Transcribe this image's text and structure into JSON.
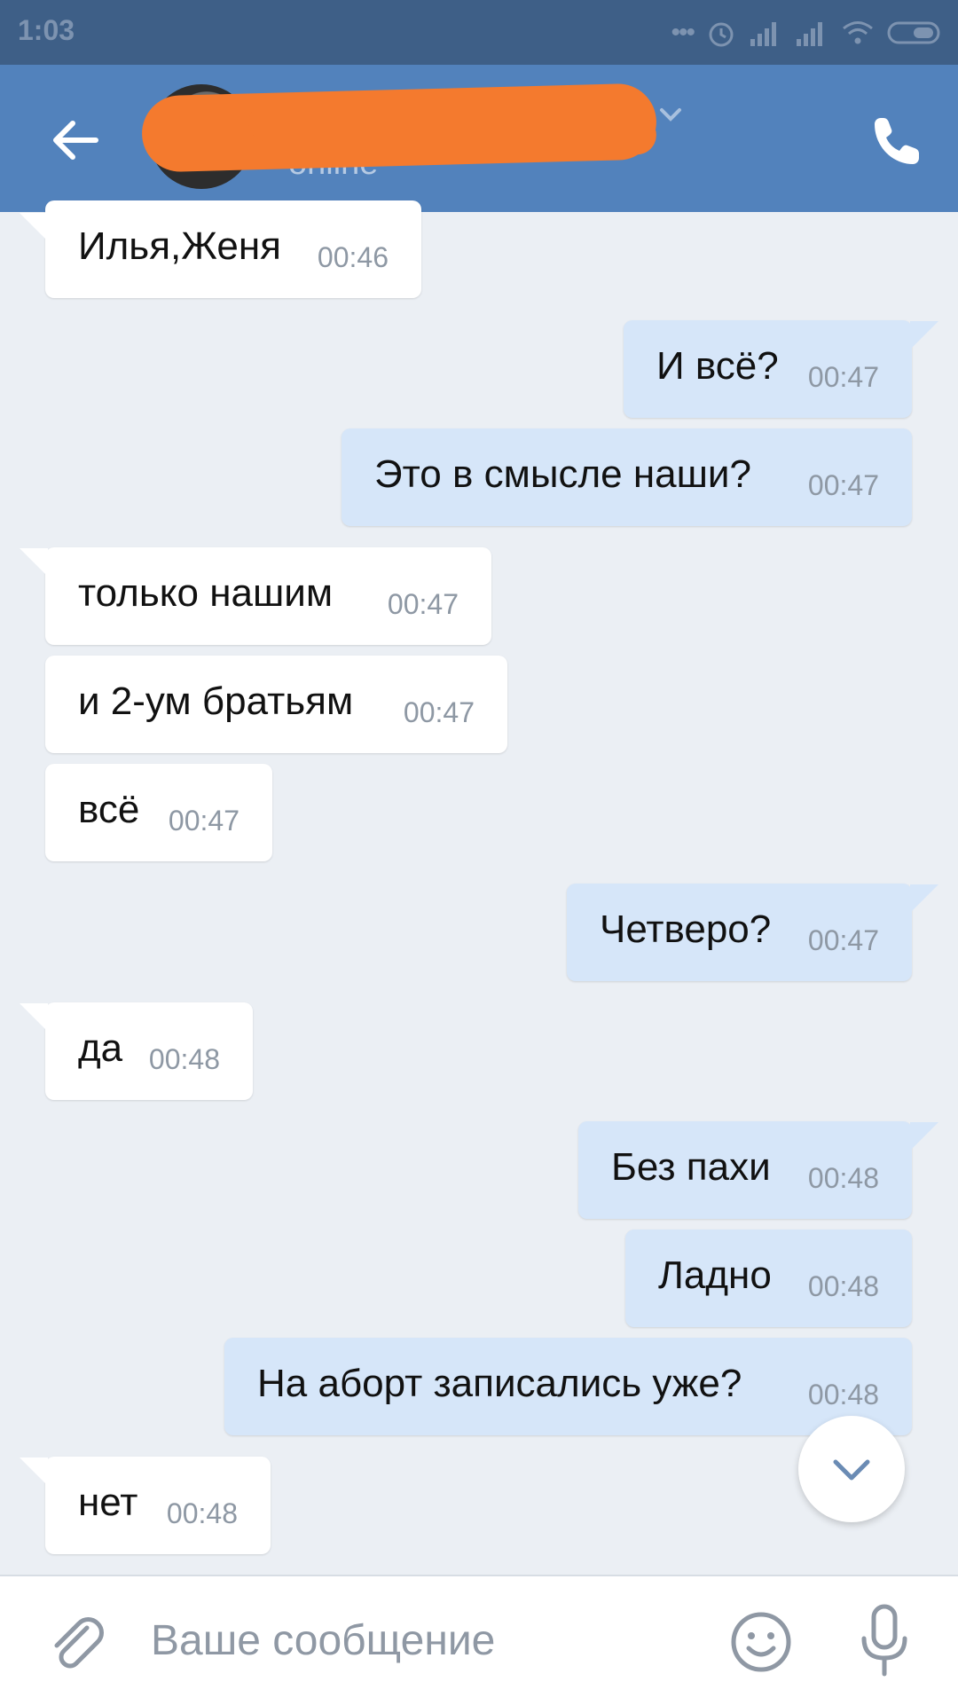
{
  "status_bar": {
    "time": "1:03"
  },
  "header": {
    "contact_name": "",
    "contact_status": "online"
  },
  "messages": [
    {
      "dir": "in",
      "text": "Илья,Женя",
      "time": "00:46"
    },
    {
      "dir": "out",
      "text": "И всё?",
      "time": "00:47"
    },
    {
      "dir": "out",
      "text": "Это в смысле наши?",
      "time": "00:47"
    },
    {
      "dir": "in",
      "text": "только нашим",
      "time": "00:47"
    },
    {
      "dir": "in",
      "text": "и 2-ум братьям",
      "time": "00:47"
    },
    {
      "dir": "in",
      "text": "всё",
      "time": "00:47"
    },
    {
      "dir": "out",
      "text": "Четверо?",
      "time": "00:47"
    },
    {
      "dir": "in",
      "text": "да",
      "time": "00:48"
    },
    {
      "dir": "out",
      "text": "Без пахи",
      "time": "00:48"
    },
    {
      "dir": "out",
      "text": "Ладно",
      "time": "00:48"
    },
    {
      "dir": "out",
      "text": "На аборт записались уже?",
      "time": "00:48"
    },
    {
      "dir": "in",
      "text": "нет",
      "time": "00:48"
    }
  ],
  "composer": {
    "placeholder": "Ваше сообщение"
  },
  "icons": {
    "back": "arrow-left-icon",
    "call": "phone-icon",
    "attach": "paperclip-icon",
    "emoji": "smile-icon",
    "mic": "microphone-icon",
    "scroll_down": "chevron-down-icon"
  },
  "colors": {
    "header": "#5282bc",
    "status_bar": "#3e5f87",
    "chat_bg": "#ebeff4",
    "outgoing_bubble": "#d6e6f9",
    "incoming_bubble": "#ffffff"
  }
}
